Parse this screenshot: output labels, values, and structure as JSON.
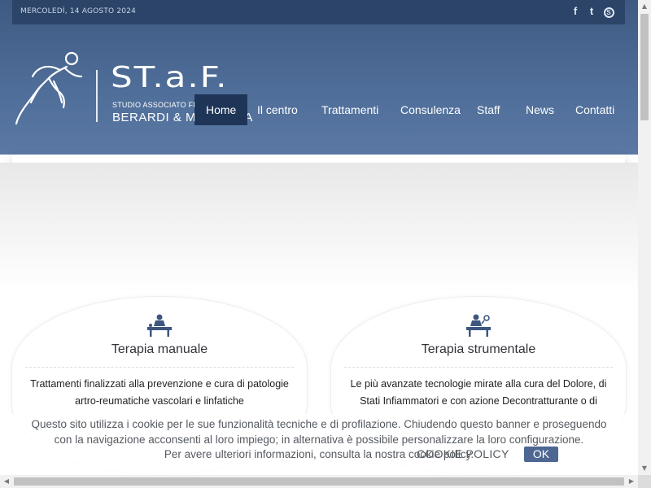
{
  "topbar": {
    "date": "MERCOLEDÌ, 14 AGOSTO 2024",
    "social": [
      {
        "icon": "facebook-icon",
        "glyph": "f"
      },
      {
        "icon": "twitter-icon",
        "glyph": "t"
      },
      {
        "icon": "skype-icon",
        "glyph": "S"
      }
    ]
  },
  "logo": {
    "title": "ST.a.F.",
    "line1": "STUDIO ASSOCIATO FISIOTERAPIA",
    "line2": "BERARDI & MARTELLA",
    "icon": "runner-logo-icon"
  },
  "nav": {
    "items": [
      {
        "label": "Home",
        "active": true
      },
      {
        "label": "Il centro"
      },
      {
        "label": "Trattamenti"
      },
      {
        "label": "Consulenza"
      },
      {
        "label": "Staff"
      },
      {
        "label": "News"
      },
      {
        "label": "Contatti"
      }
    ]
  },
  "cards": [
    {
      "icon": "massage-table-icon",
      "title": "Terapia manuale",
      "text_lines": [
        "Trattamenti finalizzati alla prevenzione e cura di patologie",
        "artro-reumatiche vascolari e linfatiche"
      ]
    },
    {
      "icon": "instrumental-therapy-icon",
      "title": "Terapia strumentale",
      "text_lines": [
        "Le più avanzate tecnologie mirate alla cura del Dolore, di",
        "Stati Infiammatori e con azione Decontratturante o di"
      ]
    }
  ],
  "cookie": {
    "lines": [
      "Questo sito utilizza i cookie per le sue funzionalità tecniche e di profilazione. Chiudendo questo banner e proseguendo",
      "con la navigazione acconsenti al loro impiego; in alternativa è possibile personalizzare la loro configurazione.",
      "Per avere ulteriori informazioni, consulta la nostra cookie policy."
    ],
    "policy_label": "COOKIE POLICY",
    "ok_label": "OK"
  },
  "colors": {
    "header": "#4f6e99",
    "topbar": "#2b4468",
    "nav_active": "#1f3558",
    "ok_button": "#4d6792"
  }
}
